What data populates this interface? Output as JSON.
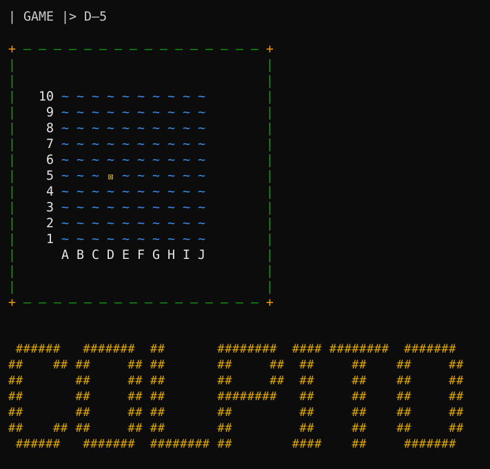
{
  "header": {
    "title": "| GAME |> D–5"
  },
  "board": {
    "rows": [
      "10",
      "9",
      "8",
      "7",
      "6",
      "5",
      "4",
      "3",
      "2",
      "1"
    ],
    "columns": [
      "A",
      "B",
      "C",
      "D",
      "E",
      "F",
      "G",
      "H",
      "I",
      "J"
    ],
    "water_glyph": "~",
    "cursor_glyph": "⊠",
    "cursor": {
      "column": "D",
      "row": "5"
    },
    "frame_corner_glyph": "+",
    "frame_horizontal_glyph": "–",
    "frame_vertical_glyph": "|",
    "colors": {
      "water": "#3b8eea",
      "cursor": "#e5b500",
      "frame_corner": "#ff9a00",
      "frame_edge": "#13a10e",
      "labels": "#e6e6e6"
    }
  },
  "banner": {
    "lines": [
      " ######   #######  ##       ########  #### ########  #######",
      "##    ## ##     ## ##       ##     ##  ##     ##    ##     ##",
      "##       ##     ## ##       ##     ##  ##     ##    ##     ##",
      "##       ##     ## ##       ########   ##     ##    ##     ##",
      "##       ##     ## ##       ##         ##     ##    ##     ##",
      "##    ## ##     ## ##       ##         ##     ##    ##     ##",
      " ######   #######  ######## ##        ####    ##     #######"
    ],
    "color": "#e0a800"
  }
}
